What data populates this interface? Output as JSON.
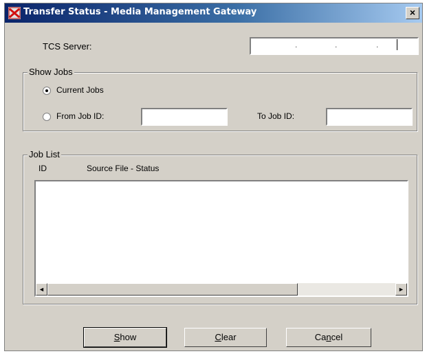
{
  "window": {
    "title": "Transfer Status - Media Management Gateway",
    "close_glyph": "×"
  },
  "server": {
    "label": "TCS Server:",
    "ip_dots": [
      ".",
      ".",
      "."
    ]
  },
  "show_jobs": {
    "legend": "Show Jobs",
    "current_jobs_label": "Current Jobs",
    "current_jobs_selected": true,
    "from_job_label": "From Job ID:",
    "from_job_value": "",
    "to_job_label": "To Job ID:",
    "to_job_value": ""
  },
  "job_list": {
    "legend": "Job List",
    "columns": [
      "ID",
      "Source File - Status"
    ],
    "rows": [],
    "scroll_left_glyph": "◄",
    "scroll_right_glyph": "►"
  },
  "buttons": {
    "show": {
      "first": "S",
      "rest": "how"
    },
    "clear": {
      "first": "C",
      "rest": "lear"
    },
    "cancel": {
      "pre": "Ca",
      "mnemonic": "n",
      "post": "cel"
    }
  },
  "icons": {
    "app": "app-icon",
    "close": "close-icon"
  },
  "colors": {
    "face": "#d4d0c8",
    "title_start": "#0a246a",
    "title_end": "#a6caf0"
  }
}
